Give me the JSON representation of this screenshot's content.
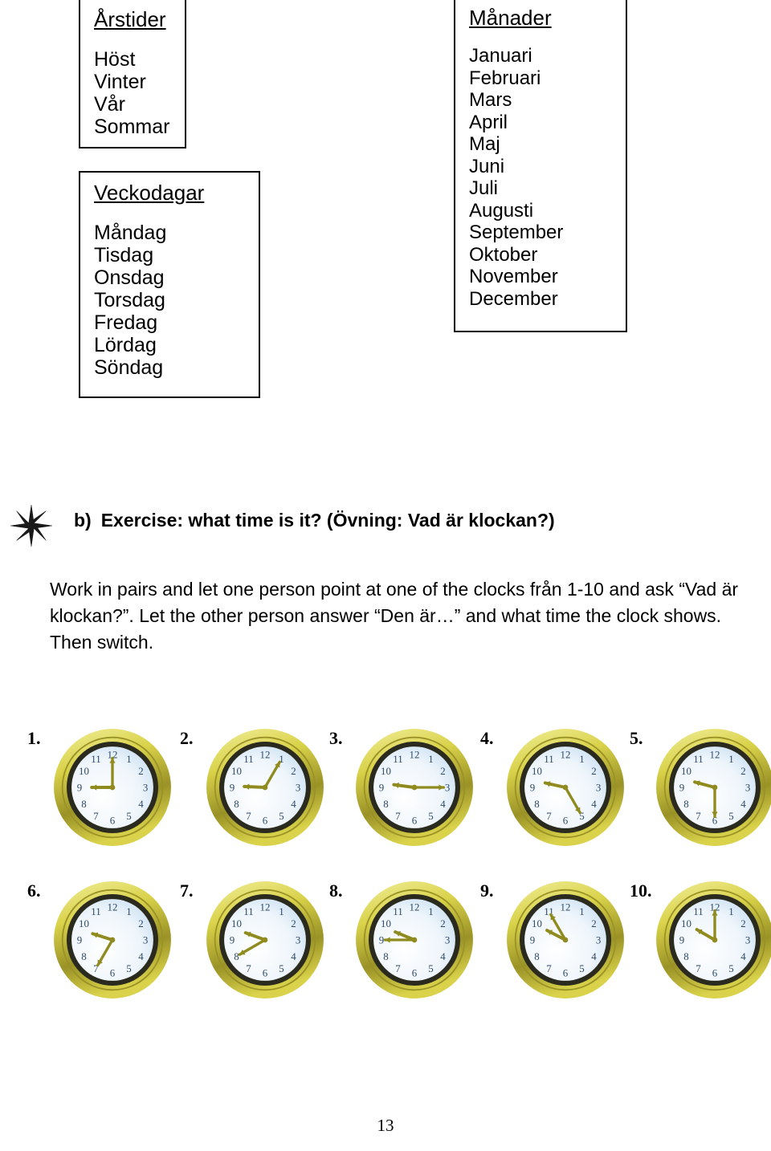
{
  "boxes": {
    "seasons": {
      "heading": "Årstider",
      "items": [
        "Höst",
        "Vinter",
        "Vår",
        "Sommar"
      ]
    },
    "weekdays": {
      "heading": "Veckodagar",
      "items": [
        "Måndag",
        "Tisdag",
        "Onsdag",
        "Torsdag",
        "Fredag",
        "Lördag",
        "Söndag"
      ]
    },
    "months": {
      "heading": "Månader",
      "items": [
        "Januari",
        "Februari",
        "Mars",
        "April",
        "Maj",
        "Juni",
        "Juli",
        "Augusti",
        "September",
        "Oktober",
        "November",
        "December"
      ]
    }
  },
  "exercise": {
    "star_icon": "eight-point-star-icon",
    "marker": "b)",
    "heading": "Exercise: what time is it? (Övning: Vad är klockan?)",
    "body": "Work in pairs and let one person point at one of the clocks från 1-10 and ask “Vad är klockan?”. Let the other person answer “Den är…” and what time the clock shows. Then switch."
  },
  "clocks": {
    "rim_color": "#d9d24a",
    "rim_highlight": "#f2ef9b",
    "rim_shadow": "#9a9226",
    "bezel_color": "#2b2a1e",
    "face_color": "#ffffff",
    "face_tint": "#bcd7ee",
    "hand_color": "#8f8b1e",
    "numeral_color": "#2e4a66",
    "items": [
      {
        "label": "1.",
        "hour": 9,
        "minute": 0,
        "time": "9:00"
      },
      {
        "label": "2.",
        "hour": 9,
        "minute": 5,
        "time": "9:05"
      },
      {
        "label": "3.",
        "hour": 9,
        "minute": 15,
        "time": "9:15"
      },
      {
        "label": "4.",
        "hour": 9,
        "minute": 25,
        "time": "9:25"
      },
      {
        "label": "5.",
        "hour": 9,
        "minute": 30,
        "time": "9:30"
      },
      {
        "label": "6.",
        "hour": 9,
        "minute": 35,
        "time": "9:35"
      },
      {
        "label": "7.",
        "hour": 9,
        "minute": 40,
        "time": "9:40"
      },
      {
        "label": "8.",
        "hour": 9,
        "minute": 45,
        "time": "9:45"
      },
      {
        "label": "9.",
        "hour": 9,
        "minute": 55,
        "time": "9:55"
      },
      {
        "label": "10.",
        "hour": 10,
        "minute": 0,
        "time": "10:00"
      }
    ],
    "numerals": [
      "12",
      "1",
      "2",
      "3",
      "4",
      "5",
      "6",
      "7",
      "8",
      "9",
      "10",
      "11"
    ]
  },
  "footer": {
    "page_number": "13"
  }
}
